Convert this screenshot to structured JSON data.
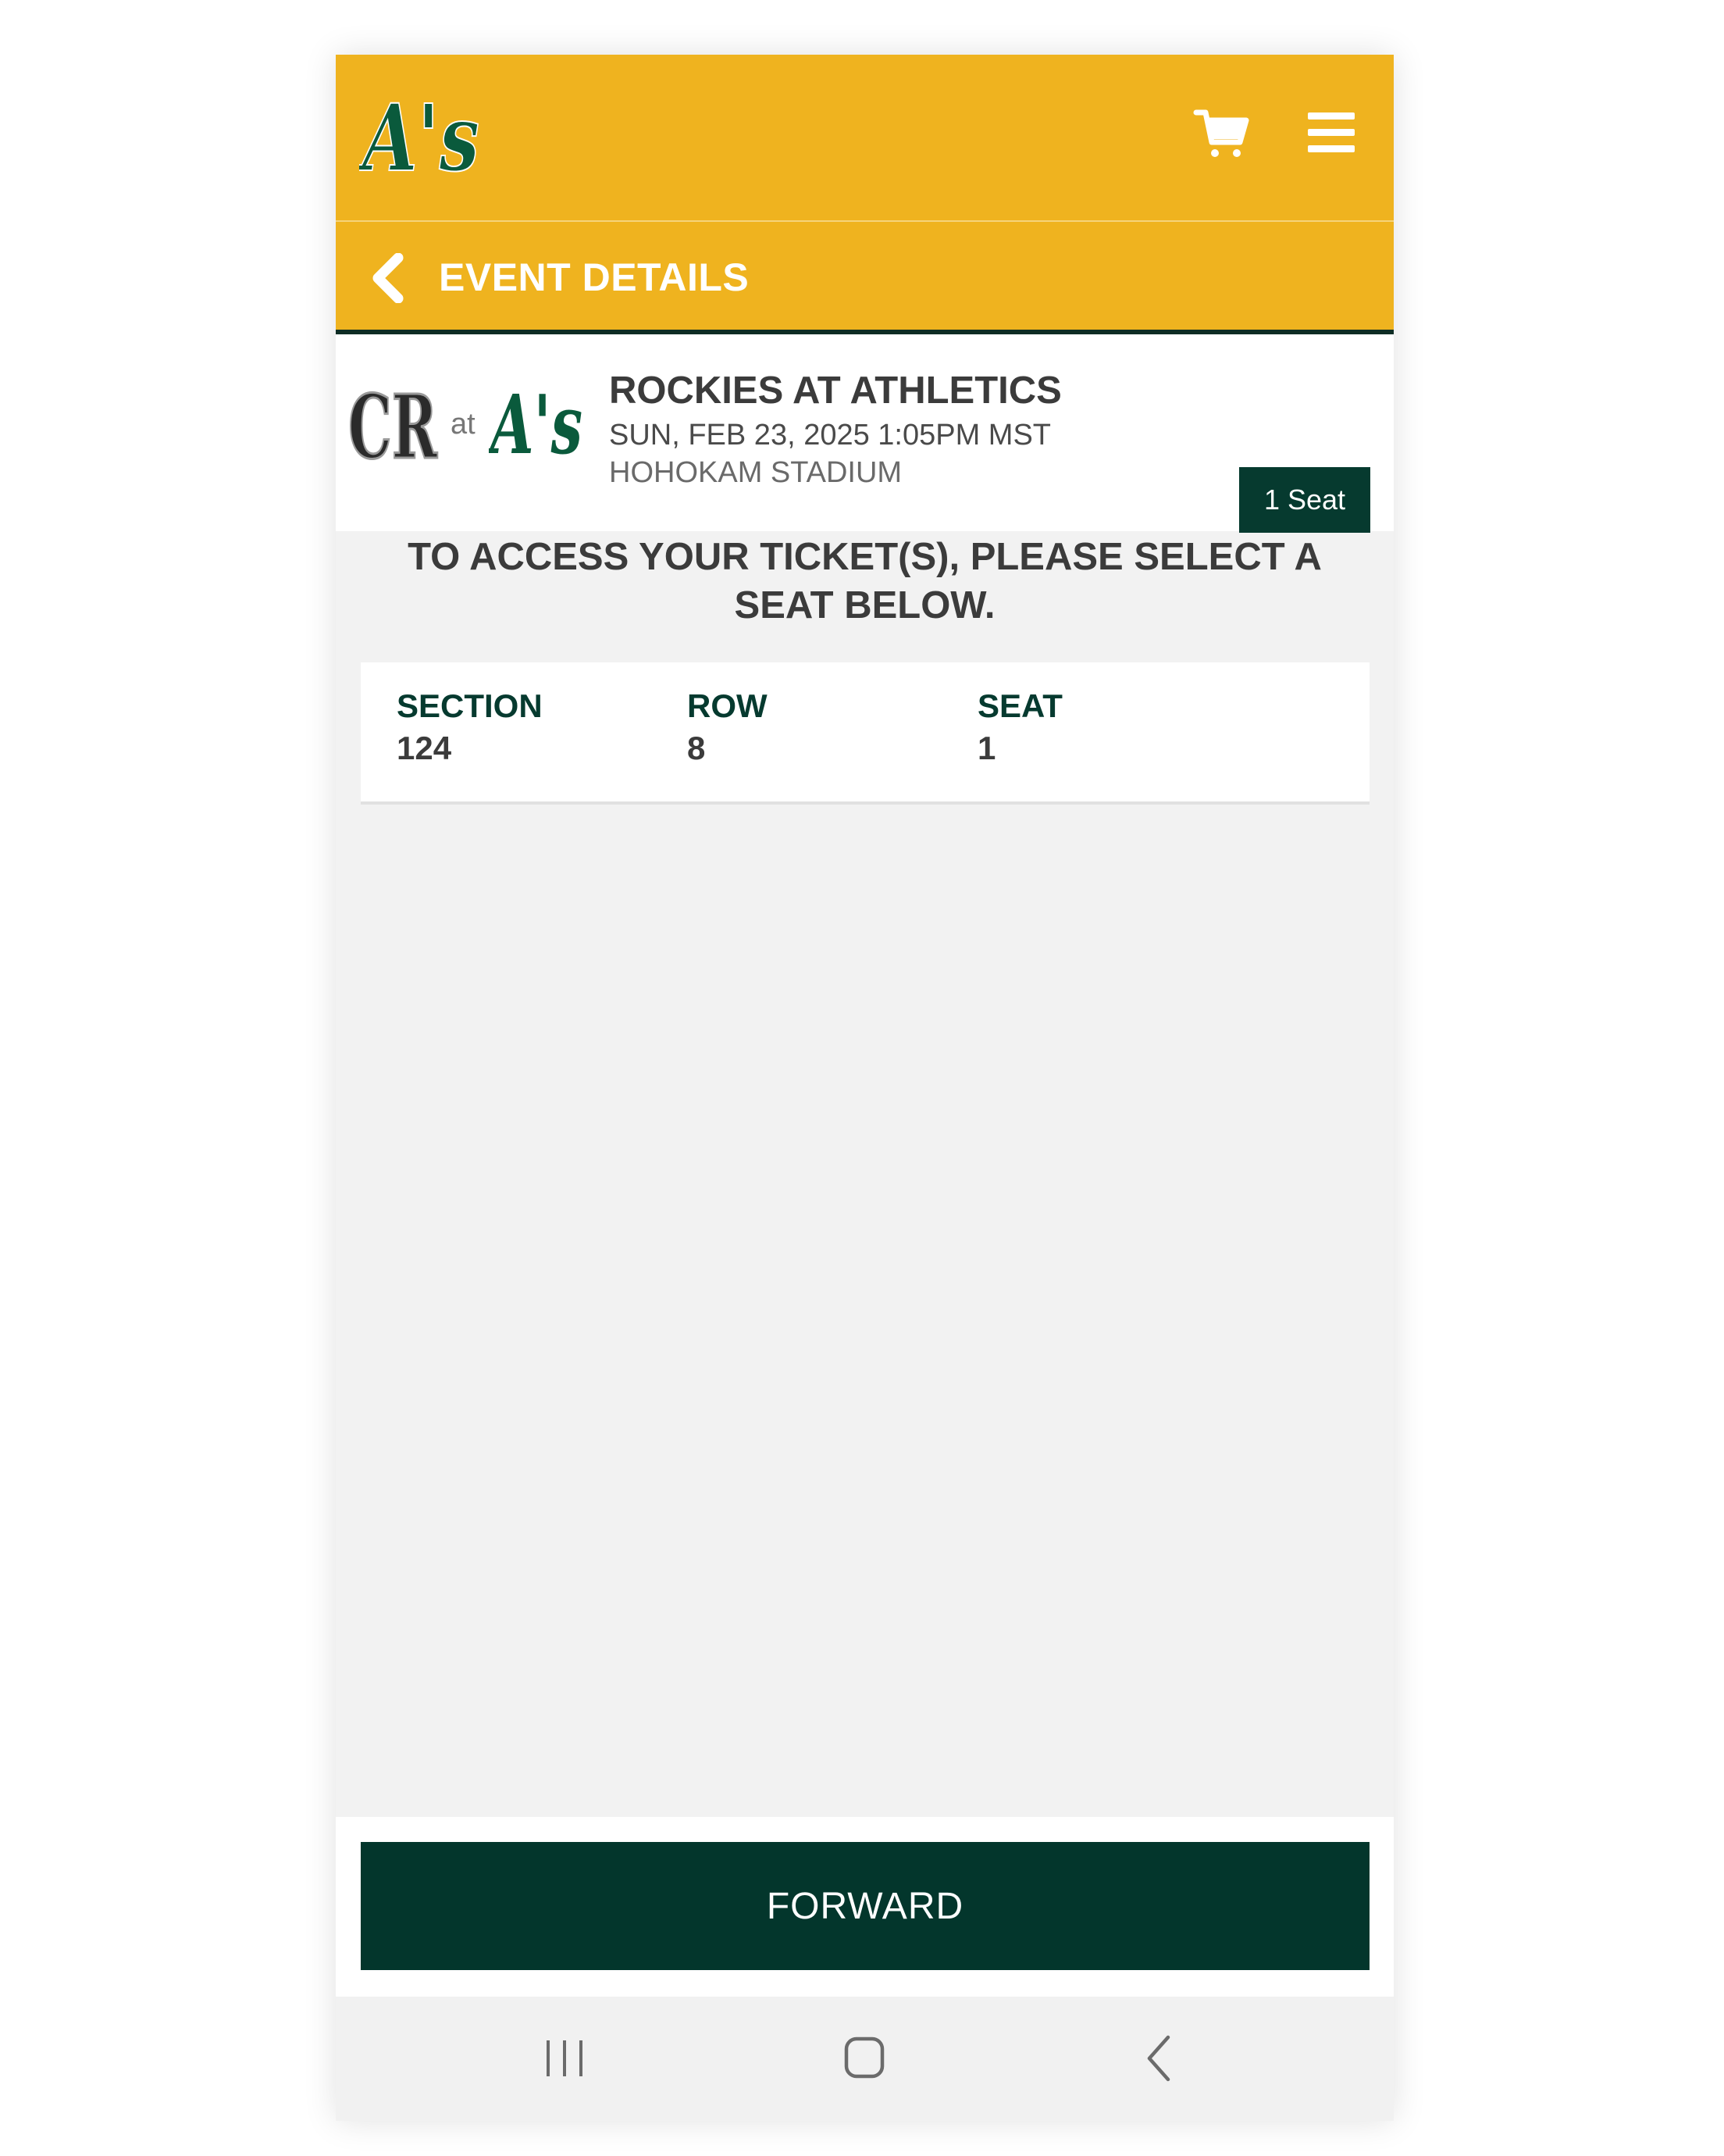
{
  "header": {
    "logo": "A's",
    "cart_icon": "cart-icon",
    "menu_icon": "hamburger-menu-icon"
  },
  "subheader": {
    "back_icon": "chevron-left-icon",
    "title": "EVENT DETAILS"
  },
  "event": {
    "away_logo": "CR",
    "at_label": "at",
    "home_logo": "A's",
    "title": "ROCKIES AT ATHLETICS",
    "date": "SUN, FEB 23, 2025 1:05PM MST",
    "venue": "HOHOKAM STADIUM",
    "seat_count": "1 Seat"
  },
  "instructions": "TO ACCESS YOUR TICKET(S), PLEASE SELECT A SEAT BELOW.",
  "seat": {
    "section_label": "SECTION",
    "section_value": "124",
    "row_label": "ROW",
    "row_value": "8",
    "seat_label": "SEAT",
    "seat_value": "1"
  },
  "actions": {
    "forward_label": "FORWARD"
  },
  "system_nav": {
    "recent_icon": "recent-apps-icon",
    "home_icon": "home-icon",
    "back_icon": "back-icon"
  },
  "colors": {
    "brand_gold": "#efb31f",
    "brand_green": "#063a2f",
    "text_dark": "#3b3b3b"
  }
}
